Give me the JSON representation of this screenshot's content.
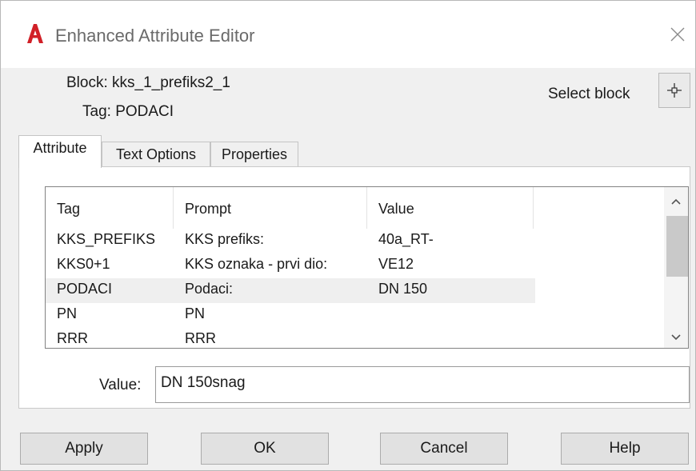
{
  "window": {
    "title": "Enhanced Attribute Editor",
    "app_icon": "autocad-a-icon",
    "close_icon": "close-icon"
  },
  "header": {
    "block_label": "Block:",
    "block_name": "kks_1_prefiks2_1",
    "tag_label": "Tag:",
    "tag_name": "PODACI",
    "select_block_label": "Select block",
    "select_block_icon": "crosshair-pick-icon"
  },
  "tabs": [
    {
      "label": "Attribute",
      "active": true
    },
    {
      "label": "Text Options",
      "active": false
    },
    {
      "label": "Properties",
      "active": false
    }
  ],
  "attribute_list": {
    "columns": [
      "Tag",
      "Prompt",
      "Value"
    ],
    "rows": [
      {
        "tag": "KKS_PREFIKS",
        "prompt": "KKS prefiks:",
        "value": "40a_RT-",
        "selected": false
      },
      {
        "tag": "KKS0+1",
        "prompt": "KKS oznaka - prvi dio:",
        "value": "VE12",
        "selected": false
      },
      {
        "tag": "PODACI",
        "prompt": "Podaci:",
        "value": "DN 150",
        "selected": true
      },
      {
        "tag": "PN",
        "prompt": "PN",
        "value": "",
        "selected": false
      },
      {
        "tag": "RRR",
        "prompt": "RRR",
        "value": "",
        "selected": false
      }
    ],
    "scroll_up_icon": "chevron-up-icon",
    "scroll_down_icon": "chevron-down-icon"
  },
  "value_field": {
    "label": "Value:",
    "value": "DN 150snag"
  },
  "buttons": {
    "apply": "Apply",
    "ok": "OK",
    "cancel": "Cancel",
    "help": "Help"
  },
  "colors": {
    "app_icon_red": "#d12027",
    "selected_row": "#efefef",
    "dialog_bg": "#f0f0f0"
  }
}
